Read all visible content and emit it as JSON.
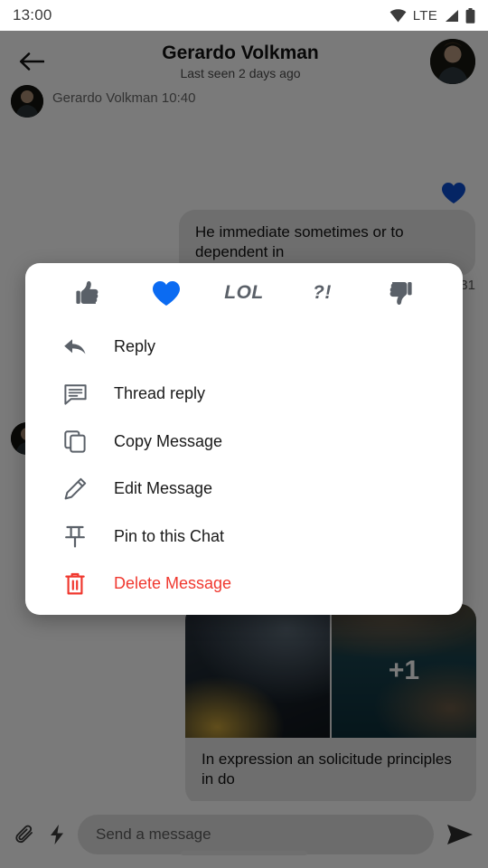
{
  "status_bar": {
    "time": "13:00",
    "network_label": "LTE",
    "icons": [
      "wifi-icon",
      "signal-icon",
      "battery-icon"
    ]
  },
  "app_bar": {
    "back_icon": "back-arrow-icon",
    "title": "Gerardo Volkman",
    "subtitle": "Last seen 2 days ago",
    "avatar": "contact-avatar"
  },
  "conversation": {
    "incoming_header": {
      "sender": "Gerardo Volkman",
      "time": "10:40"
    },
    "outgoing_message": {
      "text": "He immediate sometimes or to dependent in",
      "reaction": "heart",
      "status_icon": "sent-check-icon",
      "time": "12:31"
    },
    "media_message": {
      "overlay_count": "+1",
      "caption": "In expression an solicitude principles in do"
    }
  },
  "composer": {
    "attach_icon": "paperclip-icon",
    "quick_icon": "lightning-bolt-icon",
    "placeholder": "Send a message",
    "send_icon": "send-icon"
  },
  "popup_menu": {
    "reactions": [
      {
        "name": "thumbs-up",
        "glyph": "👍",
        "type": "icon",
        "selected": false
      },
      {
        "name": "heart",
        "glyph": "♥",
        "type": "icon",
        "selected": true
      },
      {
        "name": "lol",
        "glyph": "LOL",
        "type": "text",
        "selected": false
      },
      {
        "name": "wow",
        "glyph": "?!",
        "type": "text",
        "selected": false
      },
      {
        "name": "thumbs-down",
        "glyph": "👎",
        "type": "icon",
        "selected": false
      }
    ],
    "items": [
      {
        "label": "Reply",
        "icon": "reply-arrow-icon",
        "danger": false
      },
      {
        "label": "Thread reply",
        "icon": "thread-bubble-icon",
        "danger": false
      },
      {
        "label": "Copy Message",
        "icon": "copy-icon",
        "danger": false
      },
      {
        "label": "Edit Message",
        "icon": "pencil-icon",
        "danger": false
      },
      {
        "label": "Pin to this Chat",
        "icon": "pin-icon",
        "danger": false
      },
      {
        "label": "Delete Message",
        "icon": "trash-icon",
        "danger": true
      }
    ]
  },
  "colors": {
    "accent_blue": "#0b6bf2",
    "danger_red": "#f0382f",
    "icon_gray": "#5a6068",
    "bubble_gray": "#e6e6e6"
  }
}
